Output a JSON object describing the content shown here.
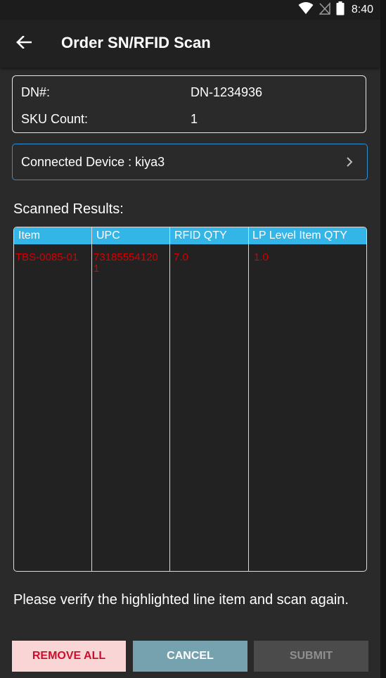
{
  "status_bar": {
    "time": "8:40",
    "icons": [
      "wifi-icon",
      "no-signal-icon",
      "battery-icon"
    ]
  },
  "app_bar": {
    "title": "Order SN/RFID Scan",
    "back_icon": "arrow-left-icon"
  },
  "order_info": {
    "dn_label": "DN#:",
    "dn_value": "DN-1234936",
    "sku_label": "SKU Count:",
    "sku_value": "1"
  },
  "device": {
    "label": "Connected Device : kiya3",
    "icon": "chevron-right-icon"
  },
  "results": {
    "section_label": "Scanned Results:",
    "columns": [
      "Item",
      "UPC",
      "RFID QTY",
      "LP Level Item QTY"
    ],
    "rows": [
      {
        "item": "TBS-0085-01",
        "upc_line1": "73185554120",
        "upc_line2": "1",
        "rfid_qty": "7.0",
        "lp_qty": "1.0"
      }
    ]
  },
  "hint": "Please verify the highlighted line item and scan again.",
  "buttons": {
    "remove_all": "REMOVE ALL",
    "cancel": "CANCEL",
    "submit": "SUBMIT"
  },
  "colors": {
    "header_accent": "#34b5e8",
    "device_border": "#2f8fd4",
    "highlight_text": "#d60000",
    "remove_bg": "#f9d6d5",
    "cancel_bg": "#76a2b0",
    "submit_bg": "#4b4b4b"
  }
}
